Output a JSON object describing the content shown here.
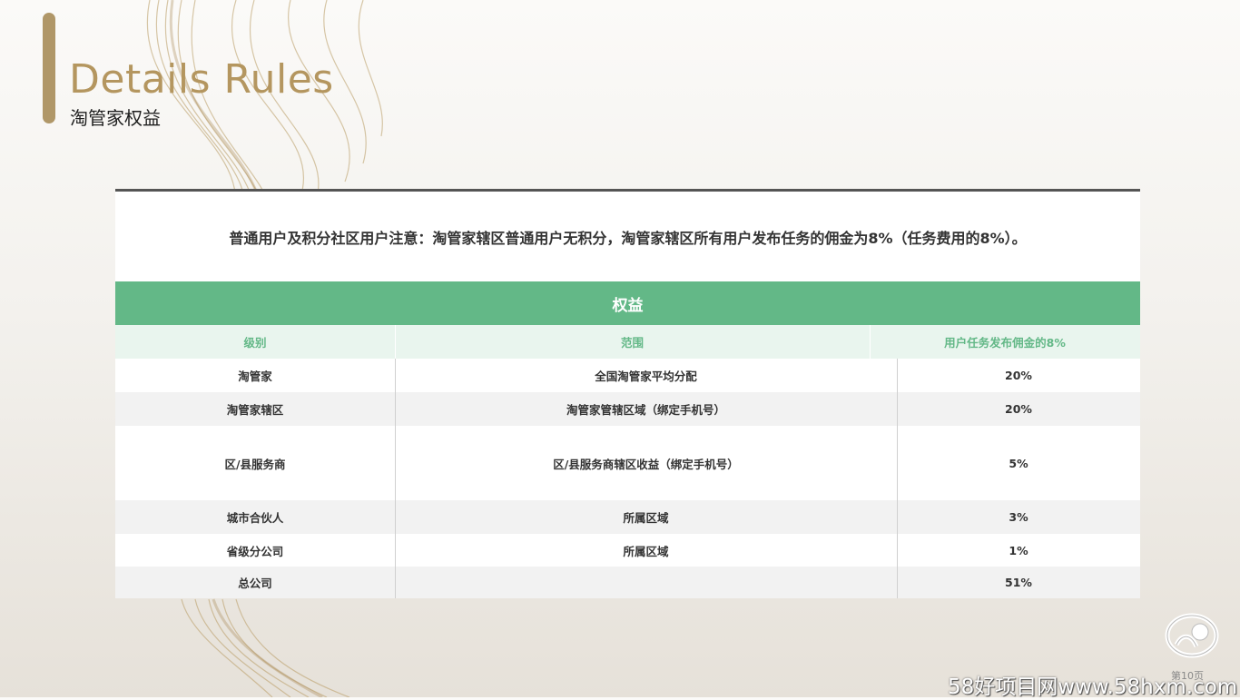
{
  "header": {
    "title_en": "Details Rules",
    "title_cn": "淘管家权益"
  },
  "notice": "普通用户及积分社区用户注意：淘管家辖区普通用户无积分，淘管家辖区所有用户发布任务的佣金为8%（任务费用的8%）。",
  "table": {
    "band_title": "权益",
    "columns": [
      "级别",
      "范围",
      "用户任务发布佣金的8%"
    ],
    "rows": [
      {
        "level": "淘管家",
        "scope": "全国淘管家平均分配",
        "pct": "20%"
      },
      {
        "level": "淘管家辖区",
        "scope": "淘管家管辖区域（绑定手机号）",
        "pct": "20%"
      },
      {
        "level": "区/县服务商",
        "scope": "区/县服务商辖区收益（绑定手机号）",
        "pct": "5%"
      },
      {
        "level": "城市合伙人",
        "scope": "所属区域",
        "pct": "3%"
      },
      {
        "level": "省级分公司",
        "scope": "所属区域",
        "pct": "1%"
      },
      {
        "level": "总公司",
        "scope": "",
        "pct": "51%"
      }
    ]
  },
  "footer": {
    "page_number": "第10页",
    "watermark": "58好项目网www.58hxm.com"
  },
  "colors": {
    "accent_gold": "#b4965f",
    "table_green": "#63b887"
  }
}
